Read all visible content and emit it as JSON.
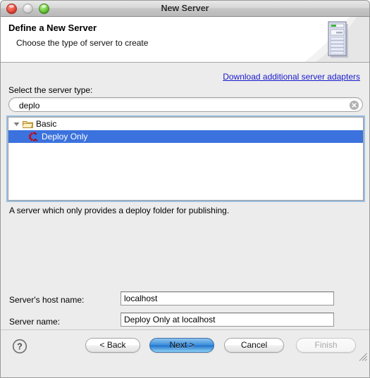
{
  "window": {
    "title": "New Server",
    "controls": {
      "close": "close-button",
      "minimize": "minimize-button",
      "zoom": "zoom-button"
    }
  },
  "header": {
    "title": "Define a New Server",
    "subtitle": "Choose the type of server to create",
    "icon": "server-tower-icon"
  },
  "main": {
    "adapters_link": "Download additional server adapters",
    "server_type_label": "Select the server type:",
    "search": {
      "value": "deplo",
      "placeholder": "",
      "clear_icon": "clear-circle-icon"
    },
    "tree": [
      {
        "label": "Basic",
        "icon": "open-folder-icon",
        "expanded": true,
        "selected": false,
        "level": 0
      },
      {
        "label": "Deploy Only",
        "icon": "deploy-only-icon",
        "expanded": false,
        "selected": true,
        "level": 1
      }
    ],
    "description": "A server which only provides a deploy folder for publishing.",
    "fields": [
      {
        "label": "Server's host name:",
        "value": "localhost",
        "name": "host-name-field"
      },
      {
        "label": "Server name:",
        "value": "Deploy Only at localhost",
        "name": "server-name-field"
      }
    ]
  },
  "footer": {
    "help": "?",
    "buttons": [
      {
        "label": "< Back",
        "state": "enabled",
        "name": "back-button"
      },
      {
        "label": "Next >",
        "state": "default",
        "name": "next-button"
      },
      {
        "label": "Cancel",
        "state": "enabled",
        "name": "cancel-button"
      },
      {
        "label": "Finish",
        "state": "disabled",
        "name": "finish-button"
      }
    ]
  },
  "colors": {
    "selection_blue": "#3b72dd",
    "link_blue": "#1919d0",
    "window_bg": "#ececec",
    "focus_ring": "#9bbee0"
  }
}
